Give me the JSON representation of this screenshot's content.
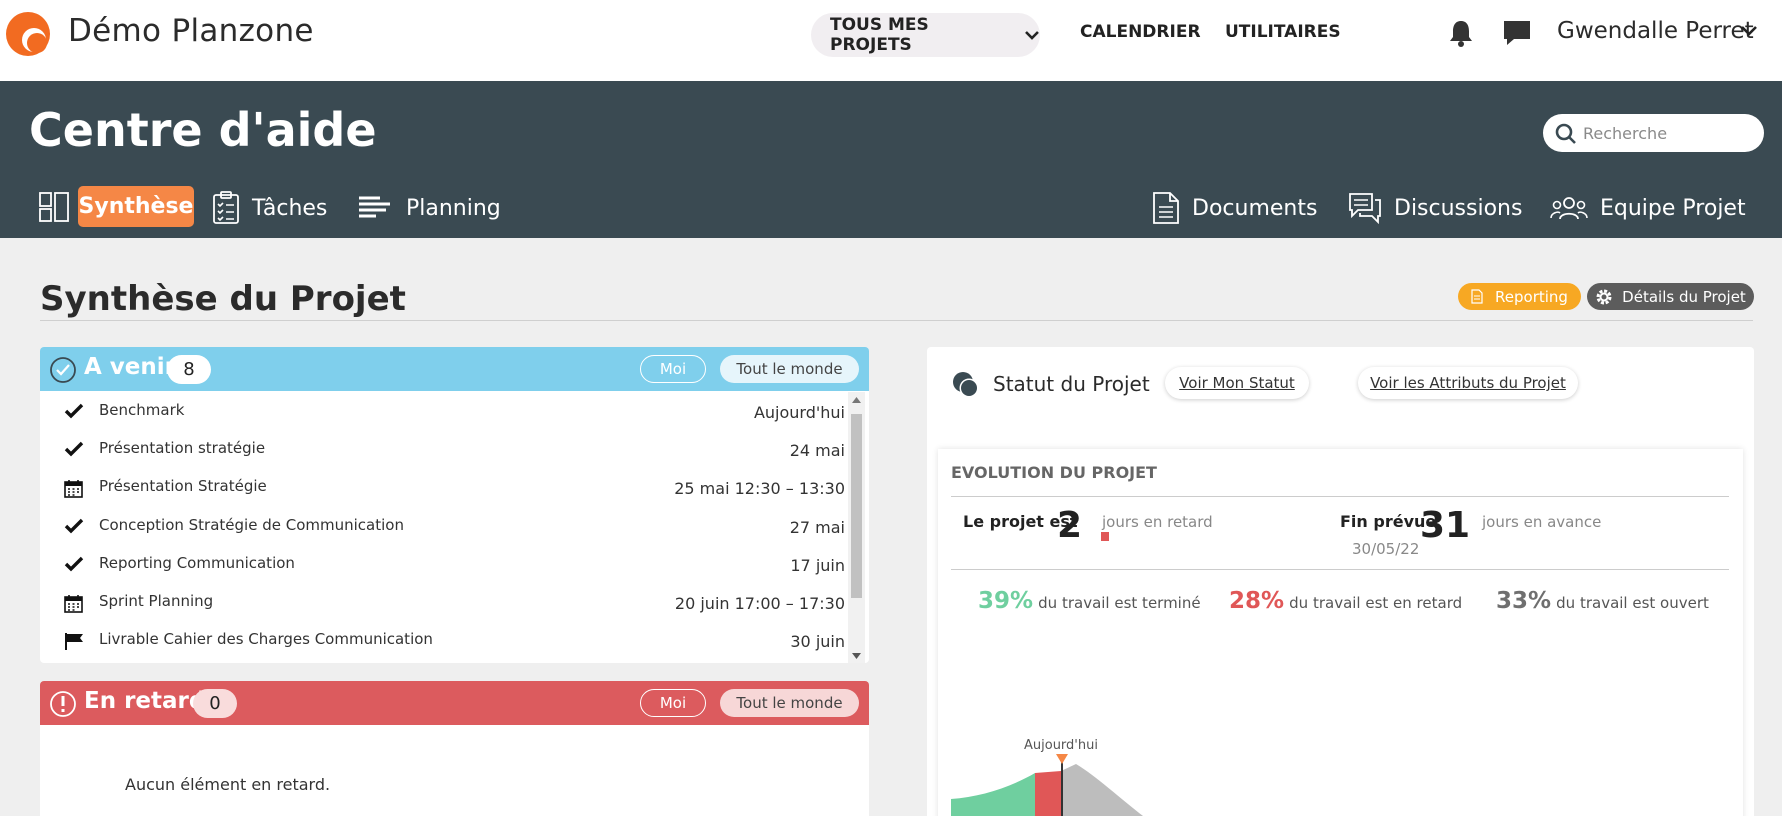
{
  "app": {
    "title": "Démo Planzone",
    "projects_label": "TOUS MES PROJETS",
    "nav": [
      {
        "label": "CALENDRIER"
      },
      {
        "label": "UTILITAIRES"
      }
    ],
    "user_name": "Gwendalle Perret"
  },
  "header": {
    "title": "Centre d'aide",
    "search_placeholder": "Recherche",
    "tabs_left": [
      {
        "label": "Synthèse",
        "icon": "dashboard-icon",
        "active": true
      },
      {
        "label": "Tâches",
        "icon": "checklist-icon"
      },
      {
        "label": "Planning",
        "icon": "gantt-icon"
      }
    ],
    "tabs_right": [
      {
        "label": "Documents",
        "icon": "document-icon"
      },
      {
        "label": "Discussions",
        "icon": "discussion-icon"
      },
      {
        "label": "Equipe Projet",
        "icon": "team-icon"
      }
    ]
  },
  "page": {
    "title": "Synthèse du Projet",
    "reporting_label": "Reporting",
    "details_label": "Détails du Projet"
  },
  "upcoming": {
    "title": "A venir",
    "count": "8",
    "filter_me": "Moi",
    "filter_all": "Tout le monde",
    "color": "#7fcfec",
    "items": [
      {
        "icon": "check-icon",
        "name": "Benchmark",
        "date": "Aujourd'hui"
      },
      {
        "icon": "check-icon",
        "name": "Présentation stratégie",
        "date": "24 mai"
      },
      {
        "icon": "calendar-icon",
        "name": "Présentation Stratégie",
        "date": "25 mai 12:30 – 13:30"
      },
      {
        "icon": "check-icon",
        "name": "Conception Stratégie de Communication",
        "date": "27 mai"
      },
      {
        "icon": "check-icon",
        "name": "Reporting Communication",
        "date": "17 juin"
      },
      {
        "icon": "calendar-icon",
        "name": "Sprint Planning",
        "date": "20 juin 17:00 – 17:30"
      },
      {
        "icon": "flag-icon",
        "name": "Livrable Cahier des Charges Communication",
        "date": "30 juin"
      }
    ]
  },
  "late": {
    "title": "En retard",
    "count": "0",
    "filter_me": "Moi",
    "filter_all": "Tout le monde",
    "color": "#dc5b5e",
    "empty_message": "Aucun élément en retard."
  },
  "status": {
    "title": "Statut du Projet",
    "link_my_status": "Voir Mon Statut",
    "link_attributes": "Voir les Attributs du Projet",
    "evolution": {
      "title": "EVOLUTION DU PROJET",
      "project_label": "Le projet est",
      "days_late_value": "2",
      "days_late_text": "jours en retard",
      "end_label": "Fin prévue",
      "end_date": "30/05/22",
      "days_ahead_value": "31",
      "days_ahead_text": "jours en avance",
      "done_pct": "39%",
      "done_text": "du travail est terminé",
      "late_pct": "28%",
      "late_text": "du travail est en retard",
      "open_pct": "33%",
      "open_text": "du travail est ouvert",
      "today_label": "Aujourd'hui",
      "colors": {
        "done": "#6fcf9f",
        "late": "#e05757",
        "open": "#bdbdbd",
        "today": "#f58746"
      }
    }
  }
}
